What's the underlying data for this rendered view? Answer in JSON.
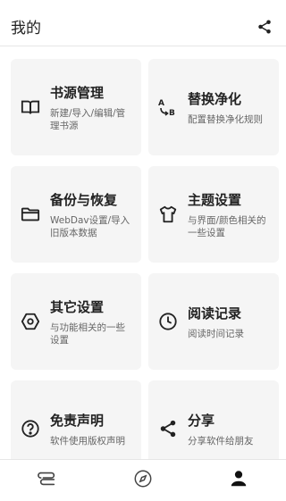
{
  "appbar": {
    "title": "我的",
    "share_icon": "share-icon"
  },
  "cards": [
    {
      "id": "book-source",
      "icon": "book-icon",
      "title": "书源管理",
      "desc": "新建/导入/编辑/管理书源"
    },
    {
      "id": "replace-rules",
      "icon": "replace-ab-icon",
      "title": "替换净化",
      "desc": "配置替换净化规则"
    },
    {
      "id": "backup",
      "icon": "folder-icon",
      "title": "备份与恢复",
      "desc": "WebDav设置/导入旧版本数据"
    },
    {
      "id": "theme",
      "icon": "tshirt-icon",
      "title": "主题设置",
      "desc": "与界面/颜色相关的一些设置"
    },
    {
      "id": "other-settings",
      "icon": "hexagon-icon",
      "title": "其它设置",
      "desc": "与功能相关的一些设置"
    },
    {
      "id": "reading-record",
      "icon": "clock-icon",
      "title": "阅读记录",
      "desc": "阅读时间记录"
    },
    {
      "id": "disclaimer",
      "icon": "question-icon",
      "title": "免责声明",
      "desc": "软件使用版权声明"
    },
    {
      "id": "share",
      "icon": "share-icon",
      "title": "分享",
      "desc": "分享软件给朋友"
    }
  ],
  "bottom_nav": [
    {
      "id": "bookshelf",
      "icon": "bookshelf-icon",
      "active": false
    },
    {
      "id": "discover",
      "icon": "compass-icon",
      "active": false
    },
    {
      "id": "my",
      "icon": "person-icon",
      "active": true
    }
  ],
  "colors": {
    "card_bg": "#f5f5f5",
    "icon": "#222222",
    "desc": "#666666"
  }
}
